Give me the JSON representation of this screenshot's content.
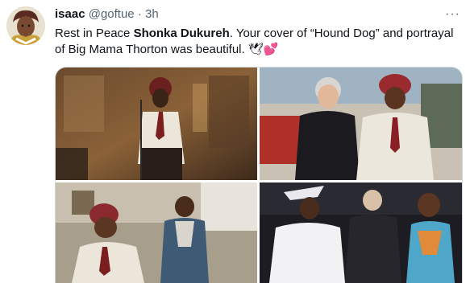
{
  "tweet": {
    "display_name": "isaac",
    "handle": "@goftue",
    "separator": "·",
    "time": "3h",
    "more_label": "···",
    "text_before": "Rest in Peace ",
    "text_bold": "Shonka Dukureh",
    "text_after": ". Your cover of “Hound Dog” and portrayal of Big Mama Thorton was beautiful. ",
    "emoji": "🕊💕"
  },
  "colors": {
    "text": "#0f1419",
    "secondary": "#536471",
    "border": "#cfd9de"
  },
  "icons": {
    "more": "more-horizontal-icon"
  }
}
